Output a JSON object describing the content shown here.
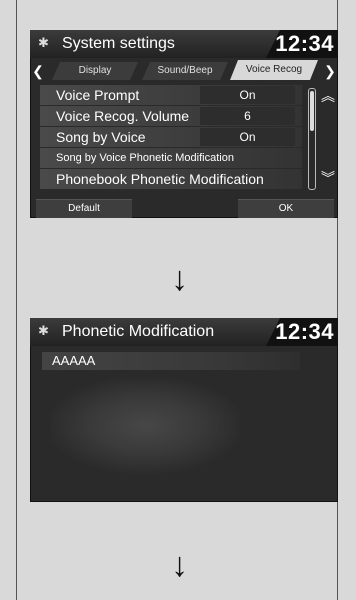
{
  "screen1": {
    "title": "System settings",
    "clock": "12:34",
    "tabs": [
      "Display",
      "Sound/Beep",
      "Voice Recog"
    ],
    "active_tab": "Voice Recog",
    "rows": [
      {
        "label": "Voice Prompt",
        "value": "On"
      },
      {
        "label": "Voice Recog. Volume",
        "value": "6"
      },
      {
        "label": "Song by Voice",
        "value": "On"
      },
      {
        "label": "Song by Voice Phonetic Modification"
      },
      {
        "label": "Phonebook Phonetic Modification"
      }
    ],
    "default_button": "Default",
    "ok_button": "OK"
  },
  "screen2": {
    "title": "Phonetic Modification",
    "clock": "12:34",
    "entry": "AAAAA"
  },
  "icons": {
    "gear": "gear-icon",
    "tab_left": "chevron-left-icon",
    "tab_right": "chevron-right-icon",
    "scroll_up": "double-chevron-up-icon",
    "scroll_down": "double-chevron-down-icon",
    "flow": "arrow-down-icon"
  }
}
